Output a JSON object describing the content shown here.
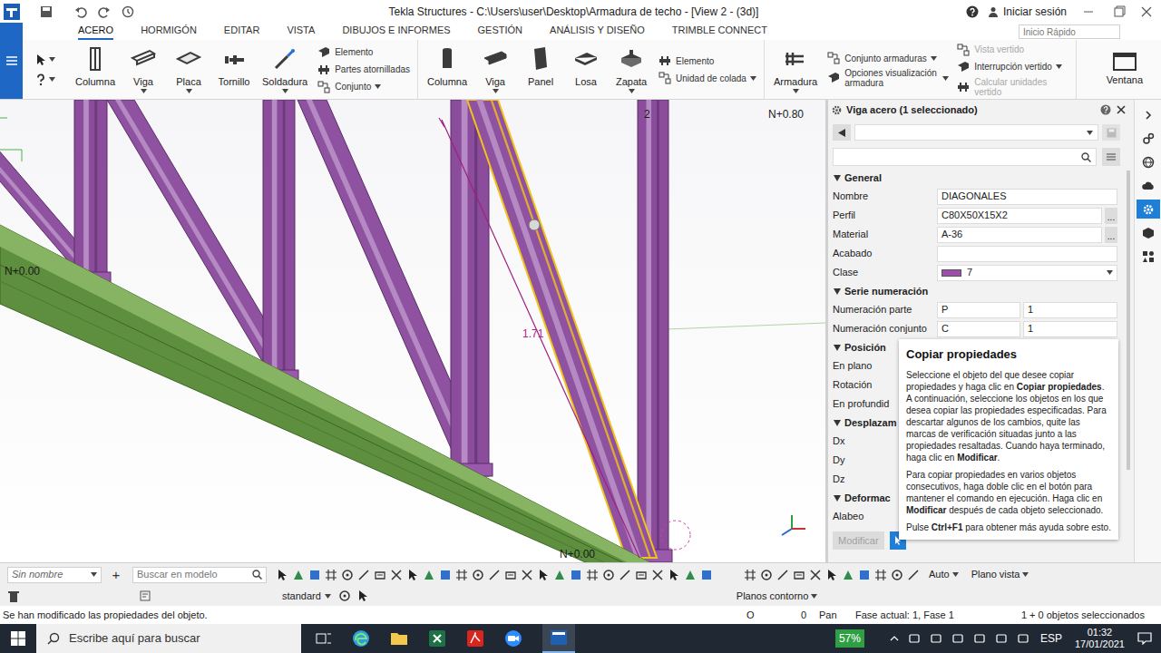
{
  "window": {
    "title": "Tekla Structures - C:\\Users\\user\\Desktop\\Armadura de techo  - [View 2 - (3d)]",
    "signin": "Iniciar sesión"
  },
  "ribbon": {
    "tabs": [
      {
        "label": "ACERO",
        "selected": true
      },
      {
        "label": "HORMIGÓN",
        "selected": false
      },
      {
        "label": "EDITAR",
        "selected": false
      },
      {
        "label": "VISTA",
        "selected": false
      },
      {
        "label": "DIBUJOS E INFORMES",
        "selected": false
      },
      {
        "label": "GESTIÓN",
        "selected": false
      },
      {
        "label": "ANÁLISIS Y DISEÑO",
        "selected": false
      },
      {
        "label": "TRIMBLE CONNECT",
        "selected": false
      }
    ],
    "quick_search": {
      "placeholder": "Inicio Rápido"
    },
    "groups": [
      {
        "items": [
          {
            "kind": "large",
            "label": "Columna",
            "dropdown": false
          },
          {
            "kind": "large",
            "label": "Viga",
            "dropdown": true
          },
          {
            "kind": "large",
            "label": "Placa",
            "dropdown": true
          },
          {
            "kind": "large",
            "label": "Tornillo",
            "dropdown": false
          },
          {
            "kind": "large",
            "label": "Soldadura",
            "dropdown": true
          },
          {
            "kind": "stack",
            "entries": [
              {
                "label": "Elemento",
                "disabled": false,
                "dropdown": false
              },
              {
                "label": "Partes atornilladas",
                "disabled": false,
                "dropdown": false
              },
              {
                "label": "Conjunto",
                "disabled": false,
                "dropdown": true
              }
            ]
          }
        ]
      },
      {
        "items": [
          {
            "kind": "large",
            "label": "Columna",
            "dropdown": false
          },
          {
            "kind": "large",
            "label": "Viga",
            "dropdown": true
          },
          {
            "kind": "large",
            "label": "Panel",
            "dropdown": false
          },
          {
            "kind": "large",
            "label": "Losa",
            "dropdown": false
          },
          {
            "kind": "large",
            "label": "Zapata",
            "dropdown": true
          },
          {
            "kind": "stack",
            "entries": [
              {
                "label": "Elemento",
                "disabled": false,
                "dropdown": false
              },
              {
                "label": "Unidad de colada",
                "disabled": false,
                "dropdown": true
              }
            ]
          }
        ]
      },
      {
        "items": [
          {
            "kind": "large",
            "label": "Armadura",
            "dropdown": true
          },
          {
            "kind": "stack",
            "entries": [
              {
                "label": "Conjunto armaduras",
                "disabled": false,
                "dropdown": true
              },
              {
                "label": "Opciones visualización armadura",
                "disabled": false,
                "dropdown": true
              }
            ]
          },
          {
            "kind": "stack",
            "entries": [
              {
                "label": "Vista vertido",
                "disabled": true,
                "dropdown": false
              },
              {
                "label": "Interrupción vertido",
                "disabled": false,
                "dropdown": true
              },
              {
                "label": "Calcular unidades vertido",
                "disabled": true,
                "dropdown": false
              }
            ]
          }
        ]
      }
    ],
    "window_button": {
      "label": "Ventana"
    }
  },
  "viewport": {
    "labels": [
      {
        "text": "N+0.00",
        "color": "#1a1a1a"
      },
      {
        "text": "N+0.00",
        "color": "#1a1a1a"
      },
      {
        "text": "N+0.80",
        "color": "#1a1a1a"
      },
      {
        "text": "2",
        "color": "#1a1a1a"
      },
      {
        "text": "1.71",
        "color": "#b0208f"
      }
    ]
  },
  "properties": {
    "title": "Viga acero (1 seleccionado)",
    "search_placeholder": "",
    "sections": [
      {
        "title": "General",
        "expanded": true,
        "rows": [
          {
            "kind": "field",
            "label": "Nombre",
            "value": "DIAGONALES"
          },
          {
            "kind": "browse",
            "label": "Perfil",
            "value": "C80X50X15X2",
            "button": "..."
          },
          {
            "kind": "browse",
            "label": "Material",
            "value": "A-36",
            "button": "..."
          },
          {
            "kind": "field",
            "label": "Acabado",
            "value": ""
          },
          {
            "kind": "class",
            "label": "Clase",
            "value": "7",
            "color": "#9b4fa9"
          }
        ]
      },
      {
        "title": "Serie numeración",
        "expanded": true,
        "rows": [
          {
            "kind": "pair",
            "label": "Numeración parte",
            "prefix": "P",
            "value": "1"
          },
          {
            "kind": "pair",
            "label": "Numeración conjunto",
            "prefix": "C",
            "value": "1"
          }
        ]
      },
      {
        "title": "Posición",
        "expanded": true,
        "rows": [
          {
            "kind": "hidden",
            "label": "En plano"
          },
          {
            "kind": "hidden",
            "label": "Rotación"
          },
          {
            "kind": "hidden",
            "label": "En profundid"
          }
        ]
      },
      {
        "title": "Desplazam",
        "expanded": true,
        "rows": [
          {
            "kind": "hidden",
            "label": "Dx"
          },
          {
            "kind": "hidden",
            "label": "Dy"
          },
          {
            "kind": "hidden",
            "label": "Dz"
          }
        ]
      },
      {
        "title": "Deformac",
        "expanded": true,
        "rows": [
          {
            "kind": "hidden",
            "label": "Alabeo"
          }
        ]
      }
    ],
    "modify": {
      "label": "Modificar",
      "disabled": true
    }
  },
  "tooltip": {
    "title": "Copiar propiedades",
    "paragraphs": [
      [
        {
          "text": "Seleccione el objeto del que desee copiar propiedades y haga clic en ",
          "bold": false
        },
        {
          "text": "Copiar propiedades",
          "bold": true
        },
        {
          "text": ". A continuación, seleccione los objetos en los que desea copiar las propiedades especificadas. Para descartar algunos de los cambios, quite las marcas de verificación situadas junto a las propiedades resaltadas. Cuando haya terminado, haga clic en ",
          "bold": false
        },
        {
          "text": "Modificar",
          "bold": true
        },
        {
          "text": ".",
          "bold": false
        }
      ],
      [
        {
          "text": "Para copiar propiedades en varios objetos consecutivos, haga doble clic en el botón para mantener el comando en ejecución. Haga clic en ",
          "bold": false
        },
        {
          "text": "Modificar",
          "bold": true
        },
        {
          "text": " después de cada objeto seleccionado.",
          "bold": false
        }
      ],
      [
        {
          "text": "Pulse ",
          "bold": false
        },
        {
          "text": "Ctrl+F1",
          "bold": true
        },
        {
          "text": " para obtener más ayuda sobre esto.",
          "bold": false
        }
      ]
    ]
  },
  "right_bar": [
    {
      "selected": false
    },
    {
      "selected": false
    },
    {
      "selected": false
    },
    {
      "selected": false
    },
    {
      "selected": true
    },
    {
      "selected": false
    },
    {
      "selected": false
    }
  ],
  "toolbar": {
    "view_name": "Sin nombre",
    "add": "+",
    "search_placeholder": "Buscar en modelo",
    "filter": "standard",
    "snap": "Auto",
    "plane": "Plano vista",
    "contour": "Planos contorno"
  },
  "status_bar": {
    "message": "Se han modificado las propiedades del objeto.",
    "origin": "O",
    "zero": "0",
    "mode": "Pan",
    "phase": "Fase actual: 1, Fase 1",
    "selection": "1 + 0 objetos seleccionados"
  },
  "taskbar": {
    "search_placeholder": "Escribe aquí para buscar",
    "battery": "57%",
    "language": "ESP",
    "time": "01:32",
    "date": "17/01/2021"
  }
}
